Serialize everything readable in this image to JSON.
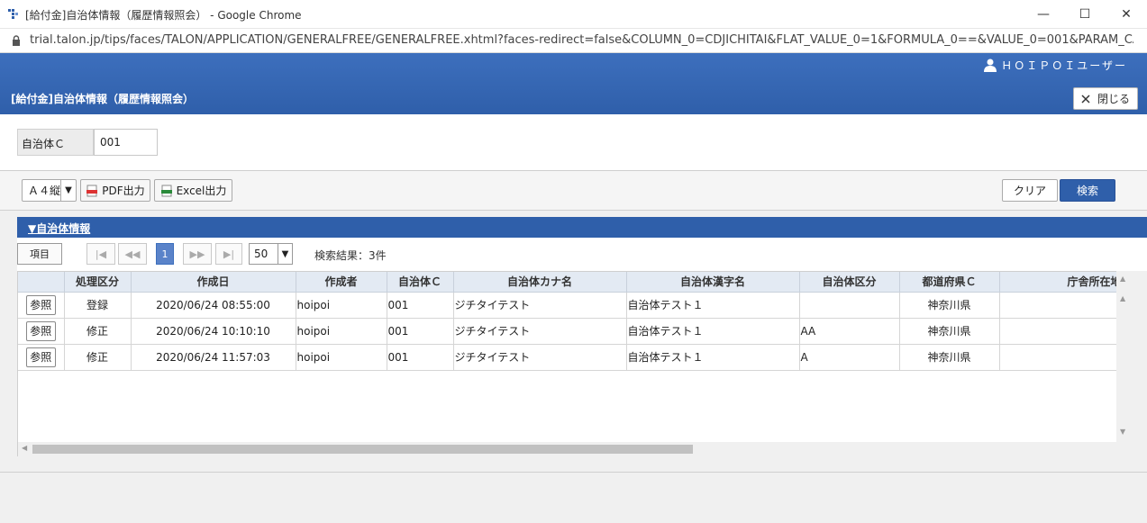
{
  "window": {
    "title": "[給付金]自治体情報（履歴情報照会） - Google Chrome",
    "minimize": "—",
    "maximize": "☐",
    "close": "✕"
  },
  "browser": {
    "url": "trial.talon.jp/tips/faces/TALON/APPLICATION/GENERALFREE/GENERALFREE.xhtml?faces-redirect=false&COLUMN_0=CDJICHITAI&FLAT_VALUE_0=1&FORMULA_0==&VALUE_0=001&PARAM_CALL..."
  },
  "header": {
    "user": "ＨＯＩＰＯＩユーザー",
    "page_title": "[給付金]自治体情報（履歴情報照会）",
    "close_label": "閉じる"
  },
  "search": {
    "label": "自治体Ｃ",
    "value": "001"
  },
  "toolbar": {
    "paper": "Ａ４縦",
    "pdf": "PDF出力",
    "excel": "Excel出力",
    "clear": "クリア",
    "search": "検索"
  },
  "section": {
    "title": "▼自治体情報"
  },
  "grid": {
    "items_label": "項目",
    "first": "|◀",
    "prev": "◀◀",
    "page": "1",
    "next": "▶▶",
    "last": "▶|",
    "page_size": "50",
    "result_count": "検索結果：3件",
    "columns": [
      "",
      "処理区分",
      "作成日",
      "作成者",
      "自治体Ｃ",
      "自治体カナ名",
      "自治体漢字名",
      "自治体区分",
      "都道府県Ｃ",
      "庁舎所在地"
    ],
    "ref_label": "参照",
    "rows": [
      {
        "kubun": "登録",
        "date": "2020/06/24 08:55:00",
        "user": "hoipoi",
        "code": "001",
        "kana": "ジチタイテスト",
        "kanji": "自治体テスト１",
        "type": "",
        "pref": "神奈川県",
        "addr": ""
      },
      {
        "kubun": "修正",
        "date": "2020/06/24 10:10:10",
        "user": "hoipoi",
        "code": "001",
        "kana": "ジチタイテスト",
        "kanji": "自治体テスト１",
        "type": "AA",
        "pref": "神奈川県",
        "addr": ""
      },
      {
        "kubun": "修正",
        "date": "2020/06/24 11:57:03",
        "user": "hoipoi",
        "code": "001",
        "kana": "ジチタイテスト",
        "kanji": "自治体テスト１",
        "type": "A",
        "pref": "神奈川県",
        "addr": ""
      }
    ]
  },
  "colors": {
    "brand": "#2f5faa",
    "header_cell": "#e3eaf3"
  }
}
